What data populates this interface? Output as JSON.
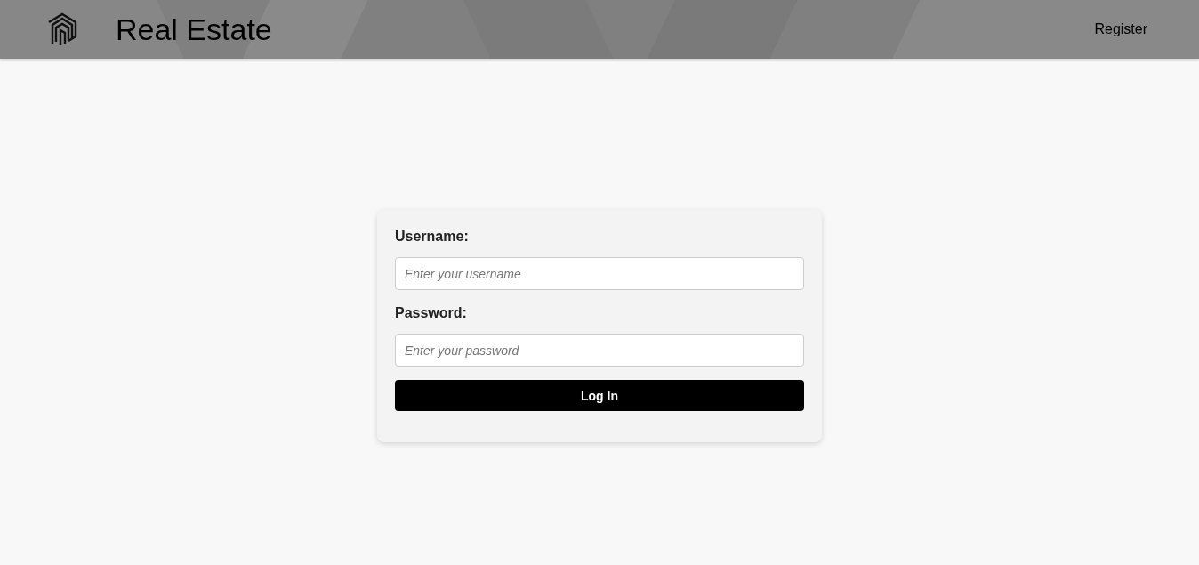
{
  "header": {
    "title": "Real Estate",
    "nav": [
      {
        "label": "Register"
      }
    ]
  },
  "login_form": {
    "fields": [
      {
        "label": "Username:",
        "placeholder": "Enter your username"
      },
      {
        "label": "Password:",
        "placeholder": "Enter your password"
      }
    ],
    "submit": "Log In"
  }
}
